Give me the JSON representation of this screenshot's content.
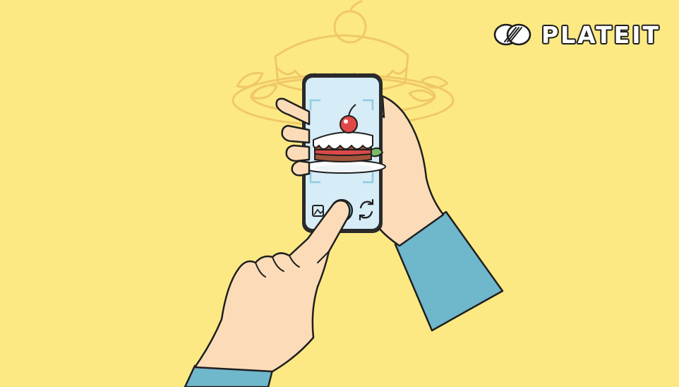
{
  "brand": {
    "name": "PLATEIT",
    "logo_icon": "fork-circle-logo-icon",
    "text_color": "#ffffff",
    "outline_color": "#1d1d1d"
  },
  "colors": {
    "background": "#fde983",
    "background_line_art": "#f0c868",
    "skin": "#fcdcb8",
    "sleeve": "#6fb7cb",
    "phone_frame": "#2a2a2a",
    "phone_screen": "#d6ecf6",
    "frosting": "#ffffff",
    "cake": "#a2553a",
    "jam": "#d94a4a",
    "cherry": "#e34848",
    "leaf": "#7cb86a"
  },
  "camera_app": {
    "gallery_icon": "gallery-image-icon",
    "shutter_icon": "shutter-button-icon",
    "switch_icon": "switch-camera-icon",
    "focus_icon": "viewfinder-focus-frame-icon"
  },
  "scene": {
    "background_art": "plate-cake-line-art-icon",
    "subject": "cake-slice-with-cherry-icon"
  }
}
